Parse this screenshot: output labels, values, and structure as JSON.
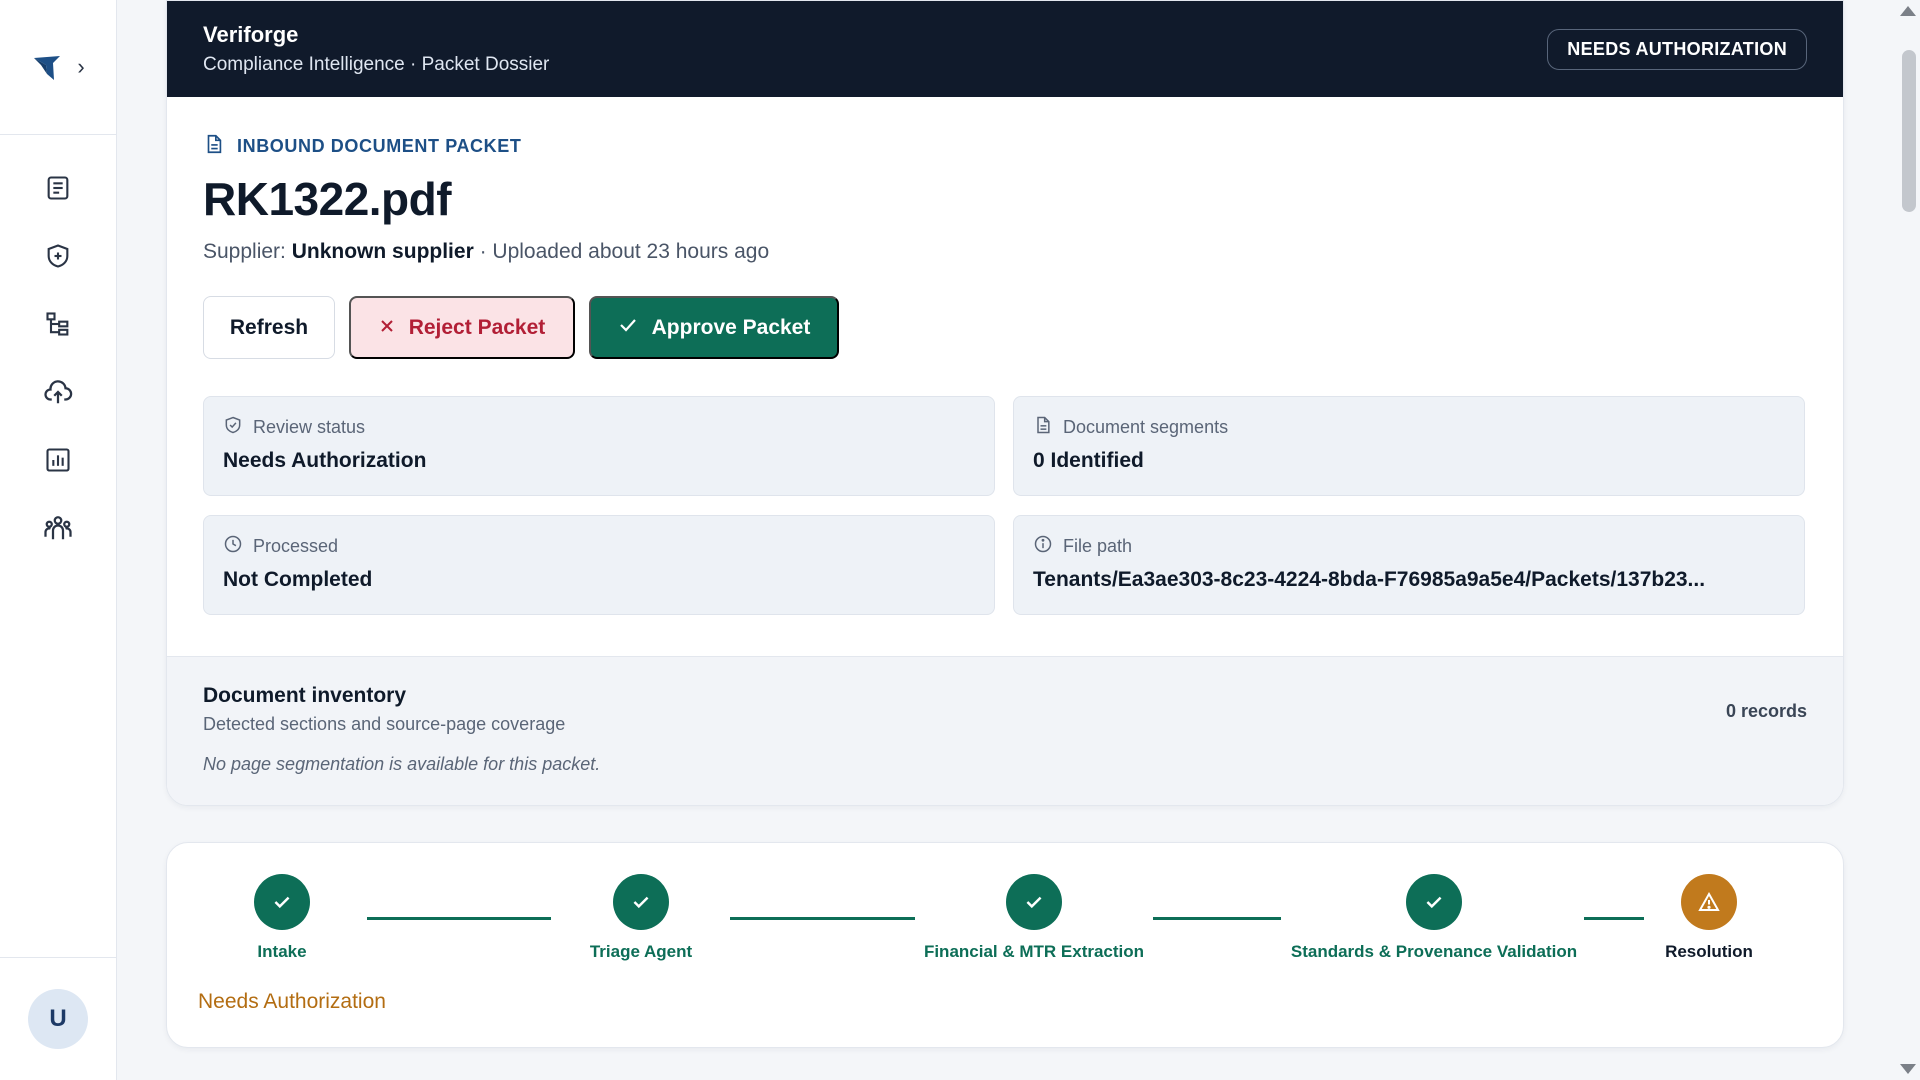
{
  "sidebar": {
    "logo_icon": "brand-bird-icon",
    "expand_icon": "chevron-right-icon",
    "nav": [
      {
        "name": "documents",
        "icon": "document-list-icon"
      },
      {
        "name": "compliance",
        "icon": "shield-plus-icon"
      },
      {
        "name": "hierarchy",
        "icon": "tree-structure-icon"
      },
      {
        "name": "upload",
        "icon": "cloud-upload-icon"
      },
      {
        "name": "analytics",
        "icon": "bar-chart-icon"
      },
      {
        "name": "team",
        "icon": "users-icon"
      }
    ],
    "avatar_initial": "U"
  },
  "header": {
    "brand": "Veriforge",
    "subtitle": "Compliance Intelligence · Packet Dossier",
    "status_pill": "NEEDS AUTHORIZATION"
  },
  "packet": {
    "kicker": "INBOUND DOCUMENT PACKET",
    "title": "RK1322.pdf",
    "supplier_label": "Supplier:",
    "supplier_name": "Unknown supplier",
    "uploaded": "· Uploaded about 23 hours ago"
  },
  "actions": {
    "refresh": "Refresh",
    "reject": "Reject Packet",
    "approve": "Approve Packet"
  },
  "tiles": [
    {
      "label": "Review status",
      "value": "Needs Authorization",
      "icon": "shield-check-icon"
    },
    {
      "label": "Document segments",
      "value": "0 Identified",
      "icon": "document-icon"
    },
    {
      "label": "Processed",
      "value": "Not Completed",
      "icon": "clock-icon"
    },
    {
      "label": "File path",
      "value": "Tenants/Ea3ae303-8c23-4224-8bda-F76985a9a5e4/Packets/137b23...",
      "icon": "info-icon"
    }
  ],
  "inventory": {
    "title": "Document inventory",
    "subtitle": "Detected sections and source-page coverage",
    "count": "0 records",
    "empty": "No page segmentation is available for this packet."
  },
  "pipeline": {
    "steps": [
      {
        "label": "Intake",
        "state": "done"
      },
      {
        "label": "Triage Agent",
        "state": "done"
      },
      {
        "label": "Financial & MTR Extraction",
        "state": "done"
      },
      {
        "label": "Standards & Provenance Validation",
        "state": "done"
      },
      {
        "label": "Resolution",
        "state": "warning"
      }
    ],
    "status": "Needs Authorization"
  },
  "colors": {
    "navy": "#101a2b",
    "green": "#0d6e57",
    "amber": "#c17a1d",
    "reject": "#b21f36"
  }
}
